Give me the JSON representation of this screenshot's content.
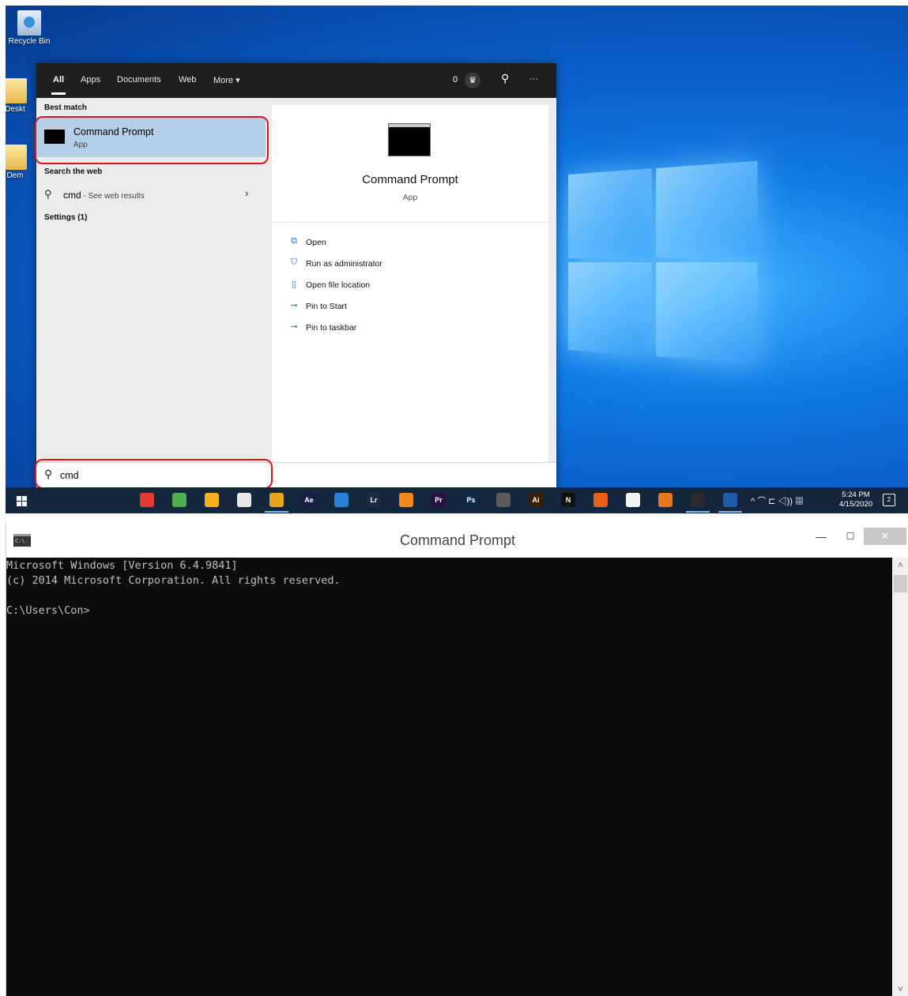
{
  "desktop": {
    "icons": [
      {
        "label": "Recycle Bin"
      },
      {
        "label": "Deskt"
      },
      {
        "label": "Dem"
      }
    ]
  },
  "search": {
    "tabs": [
      "All",
      "Apps",
      "Documents",
      "Web",
      "More ▾"
    ],
    "reward_points": "0",
    "ellipsis": "···",
    "best_match_header": "Best match",
    "best_match": {
      "title": "Command Prompt",
      "subtitle": "App"
    },
    "web_header": "Search the web",
    "web_query": "cmd",
    "web_note": " - See web results",
    "settings_header": "Settings (1)",
    "preview": {
      "title": "Command Prompt",
      "subtitle": "App",
      "actions": [
        {
          "label": "Open",
          "icon": "open-icon"
        },
        {
          "label": "Run as administrator",
          "icon": "shield-icon"
        },
        {
          "label": "Open file location",
          "icon": "file-location-icon"
        },
        {
          "label": "Pin to Start",
          "icon": "pin-icon"
        },
        {
          "label": "Pin to taskbar",
          "icon": "pin-icon"
        }
      ]
    },
    "input_value": "cmd"
  },
  "taskbar": {
    "apps": [
      {
        "name": "anydesk",
        "color": "#e33b2e",
        "text": ""
      },
      {
        "name": "utorrent",
        "color": "#4cae4c",
        "text": ""
      },
      {
        "name": "file-explorer",
        "color": "#f2b01e",
        "text": ""
      },
      {
        "name": "store",
        "color": "#e8e8e8",
        "text": ""
      },
      {
        "name": "chrome",
        "color": "#e8a41b",
        "text": ""
      },
      {
        "name": "after-effects",
        "color": "#1b1b4a",
        "text": "Ae"
      },
      {
        "name": "mail",
        "color": "#2a7fd9",
        "text": ""
      },
      {
        "name": "lightroom",
        "color": "#1b2d3f",
        "text": "Lr"
      },
      {
        "name": "vlc",
        "color": "#f08a1c",
        "text": ""
      },
      {
        "name": "premiere",
        "color": "#2a0f45",
        "text": "Pr"
      },
      {
        "name": "photoshop",
        "color": "#0d2a45",
        "text": "Ps"
      },
      {
        "name": "davinci",
        "color": "#5a5a5a",
        "text": ""
      },
      {
        "name": "illustrator",
        "color": "#3a1d05",
        "text": "Ai"
      },
      {
        "name": "netflix",
        "color": "#111111",
        "text": "N"
      },
      {
        "name": "app-orange",
        "color": "#e8601c",
        "text": ""
      },
      {
        "name": "chat",
        "color": "#f0f0f0",
        "text": ""
      },
      {
        "name": "blender",
        "color": "#e8761c",
        "text": ""
      },
      {
        "name": "cmd",
        "color": "#2b2b2b",
        "text": ""
      },
      {
        "name": "powershell",
        "color": "#1f5aa8",
        "text": ""
      }
    ],
    "tray_glyphs": "^  ⌒ ⊏ ◁)) ▦",
    "time": "5:24 PM",
    "date": "4/15/2020",
    "notifications": "2"
  },
  "cmd": {
    "title": "Command Prompt",
    "icon_text": "C:\\.",
    "minimize": "—",
    "maximize": "☐",
    "close": "✕",
    "output": "Microsoft Windows [Version 6.4.9841]\n(c) 2014 Microsoft Corporation. All rights reserved.\n\nC:\\Users\\Con>",
    "scroll_up": "˄",
    "scroll_down": "˅"
  }
}
